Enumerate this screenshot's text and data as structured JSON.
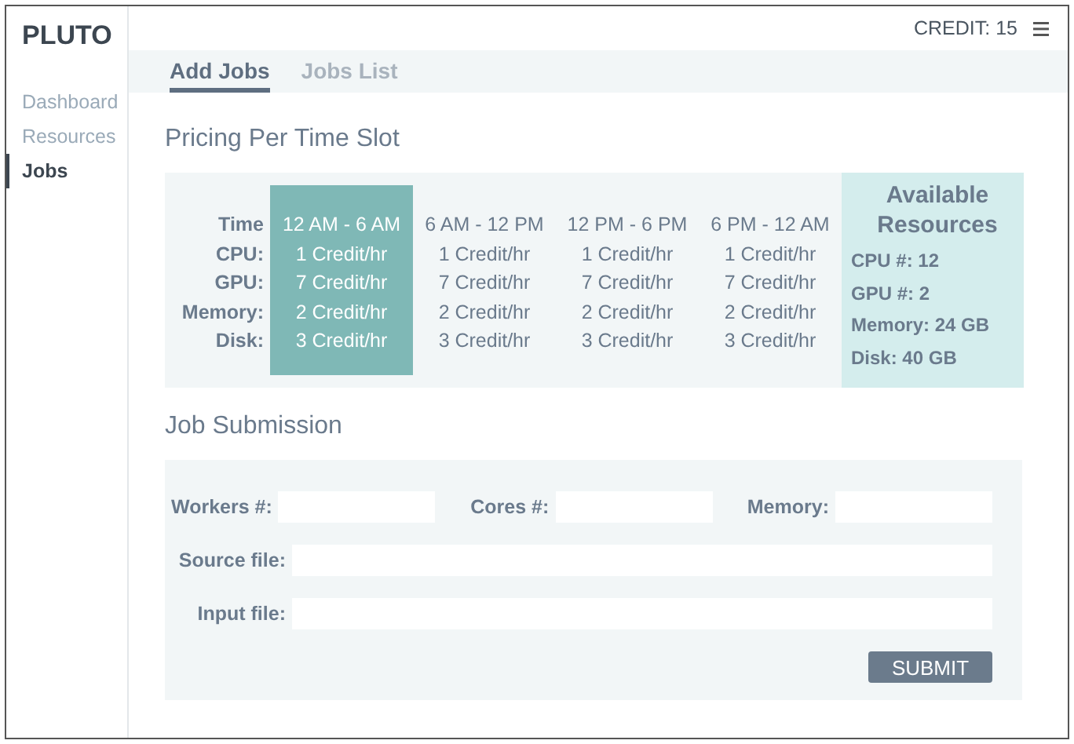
{
  "brand": "PLUTO",
  "credit": "CREDIT: 15",
  "sidebar": {
    "items": [
      {
        "label": "Dashboard",
        "selected": false
      },
      {
        "label": "Resources",
        "selected": false
      },
      {
        "label": "Jobs",
        "selected": true
      }
    ]
  },
  "tabs": [
    {
      "label": "Add Jobs",
      "selected": true
    },
    {
      "label": "Jobs List",
      "selected": false
    }
  ],
  "pricing": {
    "title": "Pricing Per Time Slot",
    "row_labels": [
      "Time",
      "CPU:",
      "GPU:",
      "Memory:",
      "Disk:"
    ],
    "slots": [
      {
        "time": "12 AM - 6 AM",
        "rates": [
          "1 Credit/hr",
          "7 Credit/hr",
          "2 Credit/hr",
          "3 Credit/hr"
        ],
        "selected": true
      },
      {
        "time": "6 AM - 12 PM",
        "rates": [
          "1 Credit/hr",
          "7 Credit/hr",
          "2 Credit/hr",
          "3 Credit/hr"
        ],
        "selected": false
      },
      {
        "time": "12 PM - 6 PM",
        "rates": [
          "1 Credit/hr",
          "7 Credit/hr",
          "2 Credit/hr",
          "3 Credit/hr"
        ],
        "selected": false
      },
      {
        "time": "6 PM - 12 AM",
        "rates": [
          "1 Credit/hr",
          "7 Credit/hr",
          "2 Credit/hr",
          "3 Credit/hr"
        ],
        "selected": false
      }
    ],
    "resources": {
      "title": "Available Resources",
      "items": [
        "CPU #: 12",
        "GPU #: 2",
        "Memory: 24 GB",
        "Disk: 40 GB"
      ]
    }
  },
  "job_submission": {
    "title": "Job Submission",
    "rows": [
      {
        "kind": "inline",
        "fields": [
          {
            "label": "Workers #:"
          },
          {
            "label": "Cores #:"
          },
          {
            "label": "Memory:"
          }
        ]
      },
      {
        "kind": "wide",
        "fields": [
          {
            "label": "Source file:"
          }
        ]
      },
      {
        "kind": "wide",
        "fields": [
          {
            "label": "Input file:"
          }
        ]
      }
    ],
    "submit": "SUBMIT"
  }
}
